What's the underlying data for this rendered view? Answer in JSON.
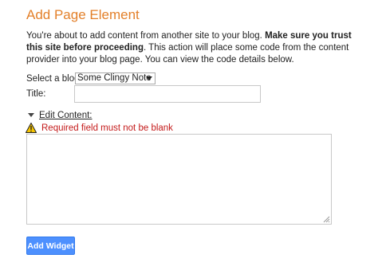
{
  "dialog": {
    "title": "Add Page Element",
    "intro_plain_1": "You're about to add content from another site to your blog. ",
    "intro_bold": "Make sure you trust this site before proceeding",
    "intro_plain_2": ". This action will place some code from the content provider into your blog page. You can view the code details below."
  },
  "form": {
    "select_blog_label": "Select a blog:",
    "blog_selected": "Some Clingy Note",
    "title_label": "Title:",
    "title_value": "",
    "edit_content_label": "Edit Content:",
    "error_message": "Required field must not be blank",
    "content_value": ""
  },
  "actions": {
    "add_widget_label": "Add Widget"
  },
  "colors": {
    "title": "#e3802a",
    "error": "#c41a1a",
    "button_bg": "#4d90fe",
    "warning_icon_fill": "#f5c400"
  },
  "icons": {
    "warning": "warning-icon",
    "expand": "triangle-down-icon",
    "select_arrow": "chevron-down-icon",
    "resize": "resize-grip-icon"
  }
}
